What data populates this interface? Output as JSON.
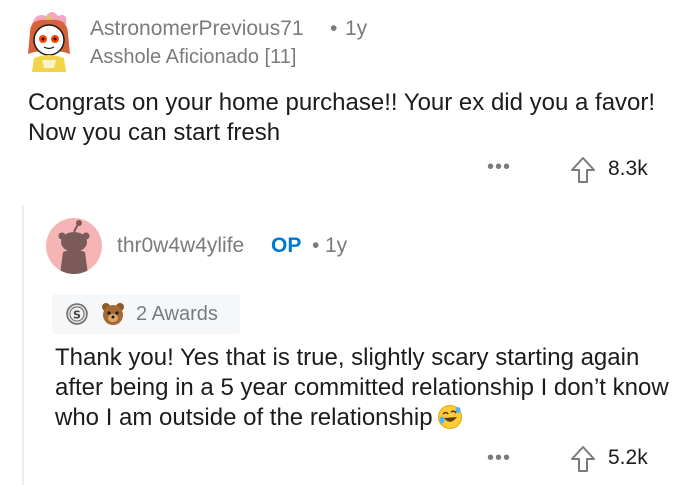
{
  "comment": {
    "username": "AstronomerPrevious71",
    "separator": "•",
    "age": "1y",
    "flair": "Asshole Aficionado [11]",
    "body": "Congrats on your home purchase!! Your ex did you a favor! Now you can start fresh",
    "more_icon": "ellipsis-icon",
    "upvote_icon": "upvote-arrow-icon",
    "votes": "8.3k"
  },
  "reply": {
    "username": "thr0w4w4ylife",
    "op_badge": "OP",
    "separator": "•",
    "age": "1y",
    "awards_label": "2 Awards",
    "body": "Thank you! Yes that is true, slightly scary starting again after being in a 5 year committed relationship I don’t know who I am outside of the relationship",
    "emoji": "rolling-on-floor-laughing-emoji",
    "more_icon": "ellipsis-icon",
    "upvote_icon": "upvote-arrow-icon",
    "votes": "5.2k"
  },
  "colors": {
    "meta_gray": "#787c7e",
    "op_blue": "#0079d3",
    "avatar_pink": "#f6b5b5"
  }
}
